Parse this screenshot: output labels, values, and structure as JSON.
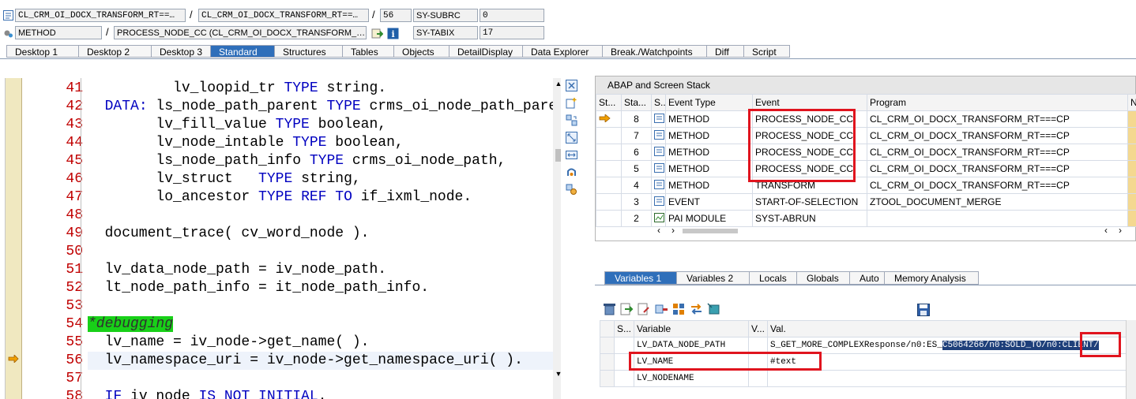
{
  "header": {
    "row1": {
      "program_main": "CL_CRM_OI_DOCX_TRANSFORM_RT==…",
      "program_include": "CL_CRM_OI_DOCX_TRANSFORM_RT==…",
      "line": "56",
      "sysvar": "SY-SUBRC",
      "sysvar_value": "0"
    },
    "row2": {
      "type": "METHOD",
      "event": "PROCESS_NODE_CC (CL_CRM_OI_DOCX_TRANSFORM_…",
      "sysvar": "SY-TABIX",
      "sysvar_value": "17"
    },
    "separator": "/"
  },
  "tabs": [
    "Desktop 1",
    "Desktop 2",
    "Desktop 3",
    "Standard",
    "Structures",
    "Tables",
    "Objects",
    "DetailDisplay",
    "Data Explorer",
    "Break./Watchpoints",
    "Diff",
    "Script"
  ],
  "active_tab": "Standard",
  "editor": {
    "line_numbers": [
      "41",
      "42",
      "43",
      "44",
      "45",
      "46",
      "47",
      "48",
      "49",
      "50",
      "51",
      "52",
      "53",
      "54",
      "55",
      "56",
      "57",
      "58"
    ],
    "current_line": "56"
  },
  "stack": {
    "title": "ABAP and Screen Stack",
    "columns": [
      "St...",
      "Sta...",
      "S...",
      "Event Type",
      "Event",
      "Program",
      "N"
    ],
    "rows": [
      {
        "level": "8",
        "type": "METHOD",
        "event": "PROCESS_NODE_CC",
        "program": "CL_CRM_OI_DOCX_TRANSFORM_RT===CP",
        "current": true
      },
      {
        "level": "7",
        "type": "METHOD",
        "event": "PROCESS_NODE_CC",
        "program": "CL_CRM_OI_DOCX_TRANSFORM_RT===CP",
        "current": false
      },
      {
        "level": "6",
        "type": "METHOD",
        "event": "PROCESS_NODE_CC",
        "program": "CL_CRM_OI_DOCX_TRANSFORM_RT===CP",
        "current": false
      },
      {
        "level": "5",
        "type": "METHOD",
        "event": "PROCESS_NODE_CC",
        "program": "CL_CRM_OI_DOCX_TRANSFORM_RT===CP",
        "current": false
      },
      {
        "level": "4",
        "type": "METHOD",
        "event": "TRANSFORM",
        "program": "CL_CRM_OI_DOCX_TRANSFORM_RT===CP",
        "current": false
      },
      {
        "level": "3",
        "type": "EVENT",
        "event": "START-OF-SELECTION",
        "program": "ZTOOL_DOCUMENT_MERGE",
        "current": false
      },
      {
        "level": "2",
        "type": "PAI MODULE",
        "event": "SYST-ABRUN",
        "program": "",
        "current": false
      }
    ]
  },
  "variables": {
    "tabs": [
      "Variables 1",
      "Variables 2",
      "Locals",
      "Globals",
      "Auto",
      "Memory Analysis"
    ],
    "active_tab": "Variables 1",
    "columns": [
      "S...",
      "Variable",
      "V...",
      "Val."
    ],
    "rows": [
      {
        "name": "LV_DATA_NODE_PATH",
        "value_pre": "S_GET_MORE_COMPLEXResponse/n0:ES_",
        "value_sel": "C5064266/n0:SOLD_TO/n0:CLIENT/"
      },
      {
        "name": "LV_NAME",
        "value_pre": "#text",
        "value_sel": ""
      },
      {
        "name": "LV_NODENAME",
        "value_pre": "",
        "value_sel": ""
      }
    ]
  },
  "colors": {
    "accent": "#2f6fba",
    "highlight_red": "#e0141e",
    "keyword_blue": "#0000c0",
    "comment_green": "#18d018",
    "line_number_red": "#c00000"
  }
}
